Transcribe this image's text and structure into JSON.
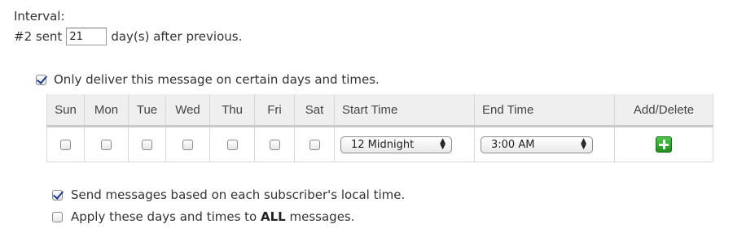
{
  "interval": {
    "label": "Interval:",
    "sent_prefix": "#2 sent",
    "days_value": "21",
    "sent_suffix": "day(s) after previous."
  },
  "only_deliver": {
    "checked": true,
    "label": "Only deliver this message on certain days and times."
  },
  "schedule": {
    "headers": {
      "sun": "Sun",
      "mon": "Mon",
      "tue": "Tue",
      "wed": "Wed",
      "thu": "Thu",
      "fri": "Fri",
      "sat": "Sat",
      "start_time": "Start Time",
      "end_time": "End Time",
      "add_delete": "Add/Delete"
    },
    "row": {
      "days_checked": [
        false,
        false,
        false,
        false,
        false,
        false,
        false
      ],
      "start_time": "12 Midnight",
      "end_time": "3:00 AM",
      "add_icon": "plus-icon",
      "add_color": "#2a9d2a"
    }
  },
  "options": {
    "local_time": {
      "checked": true,
      "label": "Send messages based on each subscriber's local time."
    },
    "apply_all": {
      "checked": false,
      "label_prefix": "Apply these days and times to ",
      "label_bold": "ALL",
      "label_suffix": " messages."
    }
  },
  "colors": {
    "check_mark": "#1a3f8f",
    "header_bg": "#efefef",
    "grid": "#d7d7d7"
  }
}
